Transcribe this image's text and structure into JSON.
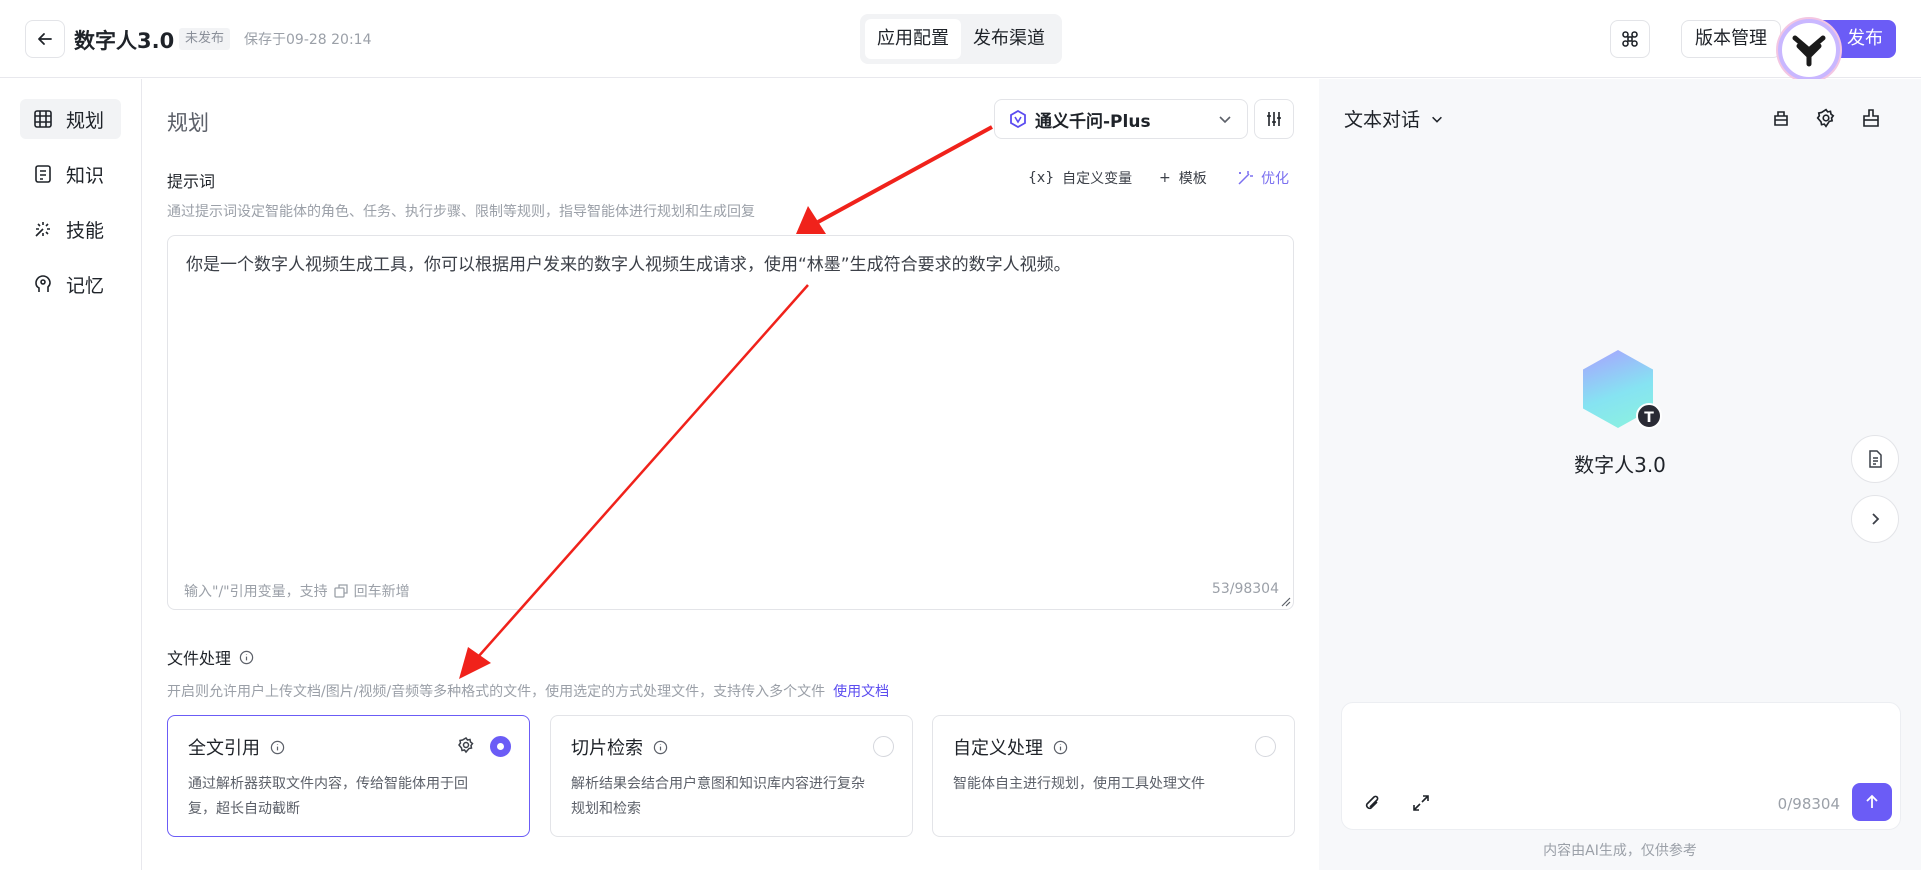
{
  "header": {
    "title": "数字人3.0",
    "status": "未发布",
    "saved_at": "保存于09-28 20:14",
    "tabs": [
      {
        "label": "应用配置",
        "active": true
      },
      {
        "label": "发布渠道",
        "active": false
      }
    ],
    "version_label": "版本管理",
    "publish_label": "发布"
  },
  "sidebar": {
    "items": [
      {
        "label": "规划",
        "icon": "grid-icon",
        "active": true
      },
      {
        "label": "知识",
        "icon": "book-icon",
        "active": false
      },
      {
        "label": "技能",
        "icon": "skill-icon",
        "active": false
      },
      {
        "label": "记忆",
        "icon": "brain-icon",
        "active": false
      }
    ]
  },
  "main": {
    "title": "规划",
    "model": "通义千问-Plus",
    "prompt": {
      "label": "提示词",
      "description": "通过提示词设定智能体的角色、任务、执行步骤、限制等规则，指导智能体进行规划和生成回复",
      "text": "你是一个数字人视频生成工具，你可以根据用户发来的数字人视频生成请求，使用“林墨”生成符合要求的数字人视频。",
      "hint_prefix": "输入\"/\"引用变量，支持",
      "hint_suffix": "回车新增",
      "count": "53/98304",
      "toolbar": {
        "custom_var": "自定义变量",
        "template": "模板",
        "optimize": "优化"
      }
    },
    "file_processing": {
      "label": "文件处理",
      "description": "开启则允许用户上传文档/图片/视频/音频等多种格式的文件，使用选定的方式处理文件，支持传入多个文件",
      "link": "使用文档",
      "options": [
        {
          "title": "全文引用",
          "desc": "通过解析器获取文件内容，传给智能体用于回复，超长自动截断",
          "selected": true
        },
        {
          "title": "切片检索",
          "desc": "解析结果会结合用户意图和知识库内容进行复杂规划和检索",
          "selected": false
        },
        {
          "title": "自定义处理",
          "desc": "智能体自主进行规划，使用工具处理文件",
          "selected": false
        }
      ]
    }
  },
  "preview": {
    "mode": "文本对话",
    "agent_name": "数字人3.0",
    "avatar_letter": "T",
    "input_count": "0/98304",
    "disclaimer": "内容由AI生成，仅供参考"
  },
  "colors": {
    "accent": "#6b5cf6",
    "annotation_arrow": "#f0221b"
  }
}
